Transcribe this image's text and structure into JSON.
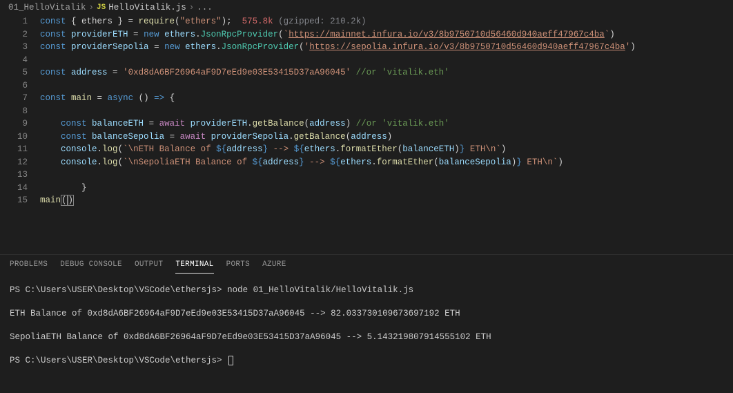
{
  "breadcrumb": {
    "folder": "01_HelloVitalik",
    "js_label": "JS",
    "file": "HelloVitalik.js",
    "dots": "..."
  },
  "line_numbers": [
    "1",
    "2",
    "3",
    "4",
    "5",
    "6",
    "7",
    "8",
    "9",
    "10",
    "11",
    "12",
    "13",
    "14",
    "15"
  ],
  "codeTokens": {
    "const": "const",
    "new": "new",
    "async": "async",
    "await": "await",
    "eq": " = ",
    "dot": ".",
    "comma": ", ",
    "arrow": " => ",
    "lb": "(",
    "rb": ")",
    "lc": "{",
    "rc": "}",
    "semi": ";",
    "bt": "`",
    "sp1": " ",
    "ethersDestr": " { ethers } ",
    "require": "require",
    "requireArg": "\"ethers\"",
    "sizeA": "575.8k",
    "sizeB": " (gzipped: 210.2k)",
    "providerETH": "providerETH",
    "providerSepolia": "providerSepolia",
    "ethers": "ethers",
    "JsonRpcProvider": "JsonRpcProvider",
    "urlMain": "https://mainnet.infura.io/v3/8b9750710d56460d940aeff47967c4ba",
    "urlSep": "https://sepolia.infura.io/v3/8b9750710d56460d940aeff47967c4ba",
    "address": "address",
    "addrLit": "'0xd8dA6BF26964aF9D7eEd9e03E53415D37aA96045'",
    "cmtAddr": " //or 'vitalik.eth'",
    "main": "main",
    "balanceETH": "balanceETH",
    "balanceSepolia": "balanceSepolia",
    "getBalance": "getBalance",
    "cmtBal": " //or 'vitalik.eth'",
    "console": "console",
    "log": "log",
    "tpl1a": "\\nETH Balance of ",
    "tpl1b": " --> ",
    "tpl1c": " ETH\\n",
    "tpl2a": "\\nSepoliaETH Balance of ",
    "formatEther": "formatEther",
    "dollar": "${",
    "closeBr": "}"
  },
  "tabs": {
    "problems": "PROBLEMS",
    "debug": "DEBUG CONSOLE",
    "output": "OUTPUT",
    "terminal": "TERMINAL",
    "ports": "PORTS",
    "azure": "AZURE"
  },
  "terminal": {
    "prompt": "PS C:\\Users\\USER\\Desktop\\VSCode\\ethersjs> ",
    "cmd": "node 01_HelloVitalik/HelloVitalik.js",
    "out1": "ETH Balance of 0xd8dA6BF26964aF9D7eEd9e03E53415D37aA96045 --> 82.033730109673697192 ETH",
    "out2": "SepoliaETH Balance of 0xd8dA6BF26964aF9D7eEd9e03E53415D37aA96045 --> 5.143219807914555102 ETH"
  }
}
